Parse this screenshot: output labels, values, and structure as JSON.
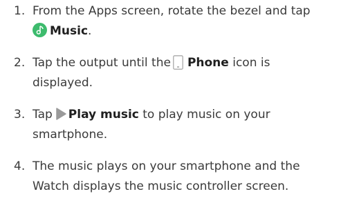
{
  "steps": [
    {
      "number": "1.",
      "text_before": "From the Apps screen, rotate the bezel and tap",
      "icon": "music-icon",
      "bold": "Music",
      "text_after": "."
    },
    {
      "number": "2.",
      "text_before": "Tap the output until the",
      "icon": "phone-icon",
      "bold": "Phone",
      "text_after_line1": "icon is",
      "text_after_line2": "displayed."
    },
    {
      "number": "3.",
      "text_before": "Tap",
      "icon": "play-icon",
      "bold": "Play music",
      "text_after_line1": "to play music on your",
      "text_after_line2": "smartphone."
    },
    {
      "number": "4.",
      "line1": "The music plays on your smartphone and the",
      "line2": "Watch displays the music controller screen."
    }
  ],
  "colors": {
    "text": "#3a3a3a",
    "bold_text": "#1f1f1f",
    "music_icon_bg": "#3dbb6d",
    "phone_icon_stroke": "#b0b0b0",
    "play_icon_fill": "#9a9a9a"
  }
}
